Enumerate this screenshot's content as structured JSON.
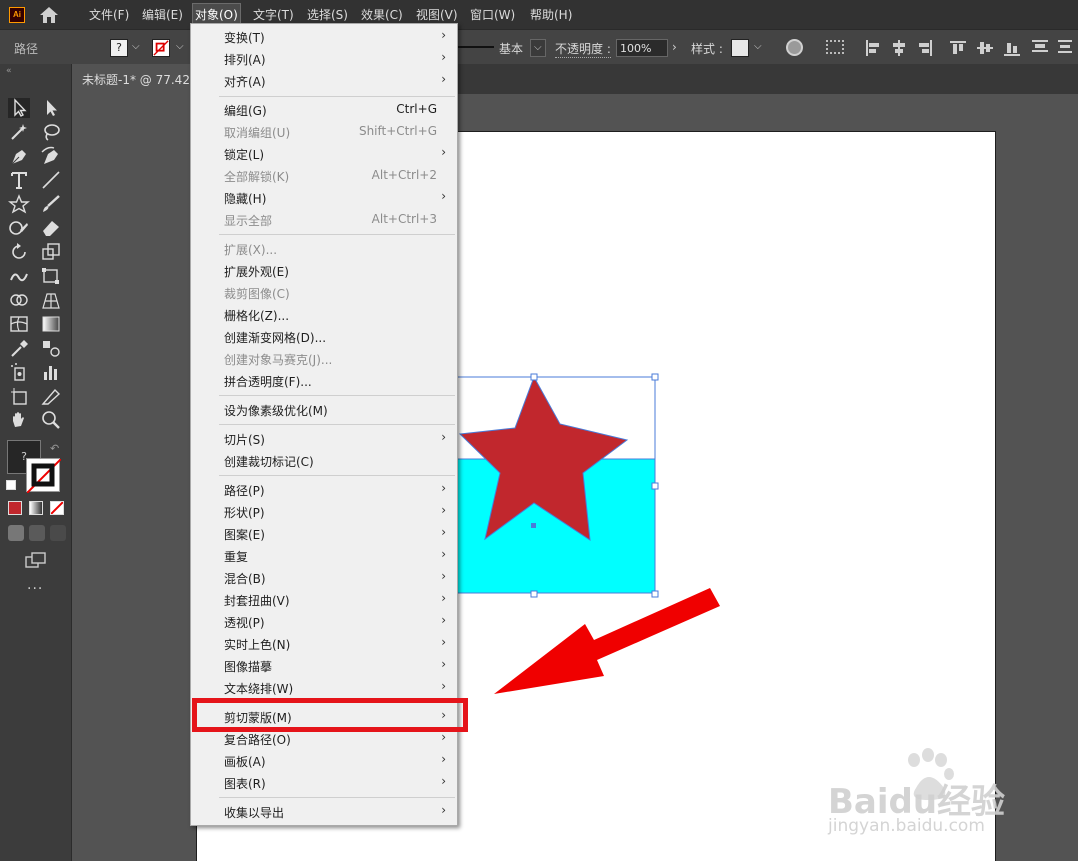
{
  "app": {
    "logo_text": "Ai"
  },
  "menubar": {
    "items": [
      "文件(F)",
      "编辑(E)",
      "对象(O)",
      "文字(T)",
      "选择(S)",
      "效果(C)",
      "视图(V)",
      "窗口(W)",
      "帮助(H)"
    ]
  },
  "controlbar": {
    "path_label": "路径",
    "fill_glyph": "?",
    "stroke_style_label": "基本",
    "opacity_label": "不透明度 :",
    "opacity_value": "100%",
    "style_label": "样式 :"
  },
  "document": {
    "tab_title": "未标题-1* @ 77.42"
  },
  "dropdown": {
    "items": [
      {
        "label": "变换(T)",
        "shortcut": "",
        "submenu": true,
        "disabled": false
      },
      {
        "label": "排列(A)",
        "shortcut": "",
        "submenu": true,
        "disabled": false
      },
      {
        "label": "对齐(A)",
        "shortcut": "",
        "submenu": true,
        "disabled": false
      },
      {
        "label": "编组(G)",
        "shortcut": "Ctrl+G",
        "submenu": false,
        "disabled": false
      },
      {
        "label": "取消编组(U)",
        "shortcut": "Shift+Ctrl+G",
        "submenu": false,
        "disabled": true
      },
      {
        "label": "锁定(L)",
        "shortcut": "",
        "submenu": true,
        "disabled": false
      },
      {
        "label": "全部解锁(K)",
        "shortcut": "Alt+Ctrl+2",
        "submenu": false,
        "disabled": true
      },
      {
        "label": "隐藏(H)",
        "shortcut": "",
        "submenu": true,
        "disabled": false
      },
      {
        "label": "显示全部",
        "shortcut": "Alt+Ctrl+3",
        "submenu": false,
        "disabled": true
      },
      {
        "label": "扩展(X)...",
        "shortcut": "",
        "submenu": false,
        "disabled": true
      },
      {
        "label": "扩展外观(E)",
        "shortcut": "",
        "submenu": false,
        "disabled": false
      },
      {
        "label": "裁剪图像(C)",
        "shortcut": "",
        "submenu": false,
        "disabled": true
      },
      {
        "label": "栅格化(Z)...",
        "shortcut": "",
        "submenu": false,
        "disabled": false
      },
      {
        "label": "创建渐变网格(D)...",
        "shortcut": "",
        "submenu": false,
        "disabled": false
      },
      {
        "label": "创建对象马赛克(J)...",
        "shortcut": "",
        "submenu": false,
        "disabled": true
      },
      {
        "label": "拼合透明度(F)...",
        "shortcut": "",
        "submenu": false,
        "disabled": false
      },
      {
        "label": "设为像素级优化(M)",
        "shortcut": "",
        "submenu": false,
        "disabled": false
      },
      {
        "label": "切片(S)",
        "shortcut": "",
        "submenu": true,
        "disabled": false
      },
      {
        "label": "创建裁切标记(C)",
        "shortcut": "",
        "submenu": false,
        "disabled": false
      },
      {
        "label": "路径(P)",
        "shortcut": "",
        "submenu": true,
        "disabled": false
      },
      {
        "label": "形状(P)",
        "shortcut": "",
        "submenu": true,
        "disabled": false
      },
      {
        "label": "图案(E)",
        "shortcut": "",
        "submenu": true,
        "disabled": false
      },
      {
        "label": "重复",
        "shortcut": "",
        "submenu": true,
        "disabled": false
      },
      {
        "label": "混合(B)",
        "shortcut": "",
        "submenu": true,
        "disabled": false
      },
      {
        "label": "封套扭曲(V)",
        "shortcut": "",
        "submenu": true,
        "disabled": false
      },
      {
        "label": "透视(P)",
        "shortcut": "",
        "submenu": true,
        "disabled": false
      },
      {
        "label": "实时上色(N)",
        "shortcut": "",
        "submenu": true,
        "disabled": false
      },
      {
        "label": "图像描摹",
        "shortcut": "",
        "submenu": true,
        "disabled": false
      },
      {
        "label": "文本绕排(W)",
        "shortcut": "",
        "submenu": true,
        "disabled": false
      },
      {
        "label": "剪切蒙版(M)",
        "shortcut": "",
        "submenu": true,
        "disabled": false
      },
      {
        "label": "复合路径(O)",
        "shortcut": "",
        "submenu": true,
        "disabled": false
      },
      {
        "label": "画板(A)",
        "shortcut": "",
        "submenu": true,
        "disabled": false
      },
      {
        "label": "图表(R)",
        "shortcut": "",
        "submenu": true,
        "disabled": false
      },
      {
        "label": "收集以导出",
        "shortcut": "",
        "submenu": true,
        "disabled": false
      }
    ],
    "submenu_arrow": "›"
  },
  "colors": {
    "star_fill": "#c1272d",
    "rect_fill": "#00ffff",
    "selection_stroke": "#4a7bd8",
    "annotation_red": "#e5141a"
  },
  "watermark": {
    "brand": "Baidu经验",
    "url": "jingyan.baidu.com"
  }
}
